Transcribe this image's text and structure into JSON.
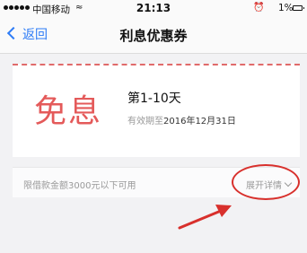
{
  "status_bar": {
    "carrier": "中国移动",
    "time": "21:13",
    "battery": "1%"
  },
  "nav": {
    "back_label": "返回",
    "title": "利息优惠券"
  },
  "coupon": {
    "type_text": "免息",
    "period": "第1-10天",
    "validity_prefix": "有效期至",
    "validity_date": "2016年12月31日"
  },
  "footer": {
    "limit_text": "限借款金额3000元以下可用",
    "expand_label": "展开详情"
  },
  "colors": {
    "accent_blue": "#2e7cf6",
    "coupon_red": "#e45a5a",
    "annotation_red": "#d8302c"
  }
}
